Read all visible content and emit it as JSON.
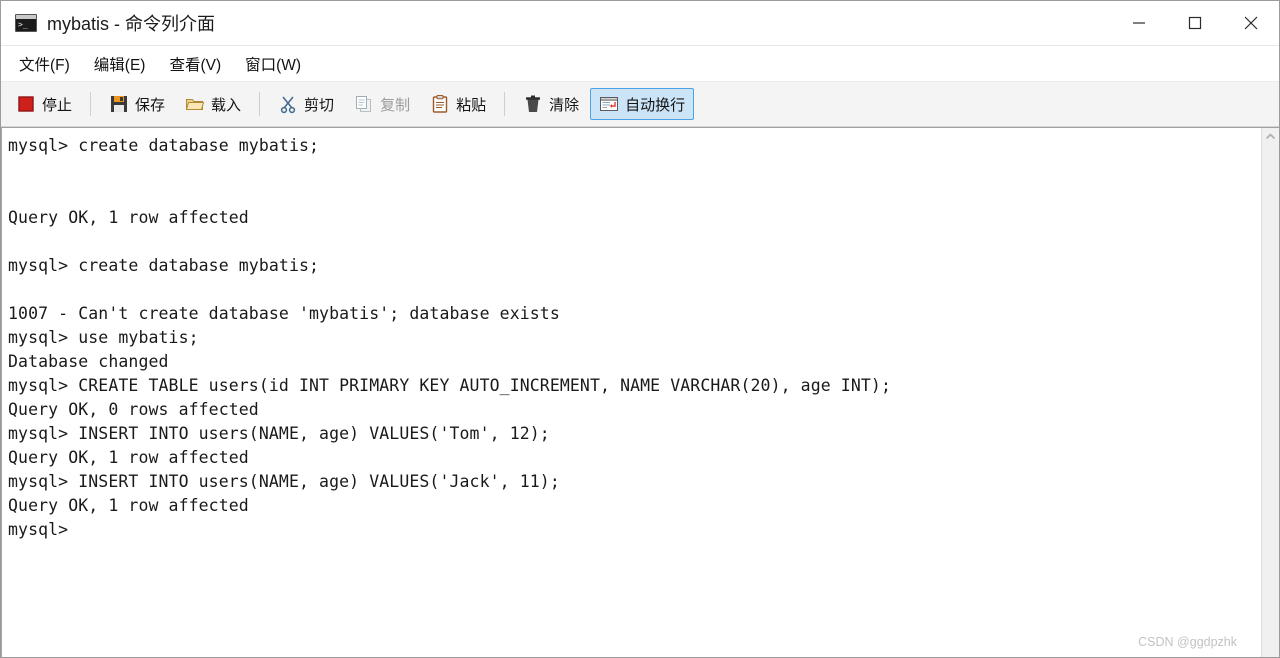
{
  "window": {
    "title": "mybatis - 命令列介面",
    "icon": "console-icon",
    "controls": {
      "minimize": "minimize-icon",
      "maximize": "maximize-icon",
      "close": "close-icon"
    }
  },
  "menubar": {
    "items": [
      {
        "label": "文件(F)",
        "text": "文件",
        "accel": "F"
      },
      {
        "label": "编辑(E)",
        "text": "编辑",
        "accel": "E"
      },
      {
        "label": "查看(V)",
        "text": "查看",
        "accel": "V"
      },
      {
        "label": "窗口(W)",
        "text": "窗口",
        "accel": "W"
      }
    ]
  },
  "toolbar": {
    "stop_label": "停止",
    "save_label": "保存",
    "load_label": "载入",
    "cut_label": "剪切",
    "copy_label": "复制",
    "paste_label": "粘贴",
    "clear_label": "清除",
    "wordwrap_label": "自动换行",
    "wordwrap_active": true,
    "copy_disabled": true,
    "icons": {
      "stop": "stop-square-icon",
      "save": "floppy-disk-icon",
      "load": "open-folder-icon",
      "cut": "scissors-icon",
      "copy": "copy-pages-icon",
      "paste": "clipboard-icon",
      "clear": "trash-can-icon",
      "wordwrap": "word-wrap-icon"
    },
    "colors": {
      "stop_red": "#d0201e",
      "active_fill": "#cce4f7",
      "active_border": "#4ea3e5",
      "folder_yellow": "#f2d28a",
      "scissors_blue": "#41698f",
      "clipboard_brown": "#9c5a2a",
      "disabled_gray": "#9d9d9d"
    }
  },
  "console": {
    "text": "mysql> create database mybatis;\n\n\nQuery OK, 1 row affected\n\nmysql> create database mybatis;\n\n1007 - Can't create database 'mybatis'; database exists\nmysql> use mybatis;\nDatabase changed\nmysql> CREATE TABLE users(id INT PRIMARY KEY AUTO_INCREMENT, NAME VARCHAR(20), age INT);\nQuery OK, 0 rows affected\nmysql> INSERT INTO users(NAME, age) VALUES('Tom', 12);\nQuery OK, 1 row affected\nmysql> INSERT INTO users(NAME, age) VALUES('Jack', 11);\nQuery OK, 1 row affected\nmysql>",
    "lines": [
      "mysql> create database mybatis;",
      "",
      "",
      "Query OK, 1 row affected",
      "",
      "mysql> create database mybatis;",
      "",
      "1007 - Can't create database 'mybatis'; database exists",
      "mysql> use mybatis;",
      "Database changed",
      "mysql> CREATE TABLE users(id INT PRIMARY KEY AUTO_INCREMENT, NAME VARCHAR(20), age INT);",
      "Query OK, 0 rows affected",
      "mysql> INSERT INTO users(NAME, age) VALUES('Tom', 12);",
      "Query OK, 1 row affected",
      "mysql> INSERT INTO users(NAME, age) VALUES('Jack', 11);",
      "Query OK, 1 row affected",
      "mysql>"
    ],
    "background": "#ffffff",
    "foreground": "#1a1a1a"
  },
  "scrollbar": {
    "up_arrow": "chevron-up-icon"
  },
  "watermark": {
    "text": "CSDN @ggdpzhk"
  }
}
